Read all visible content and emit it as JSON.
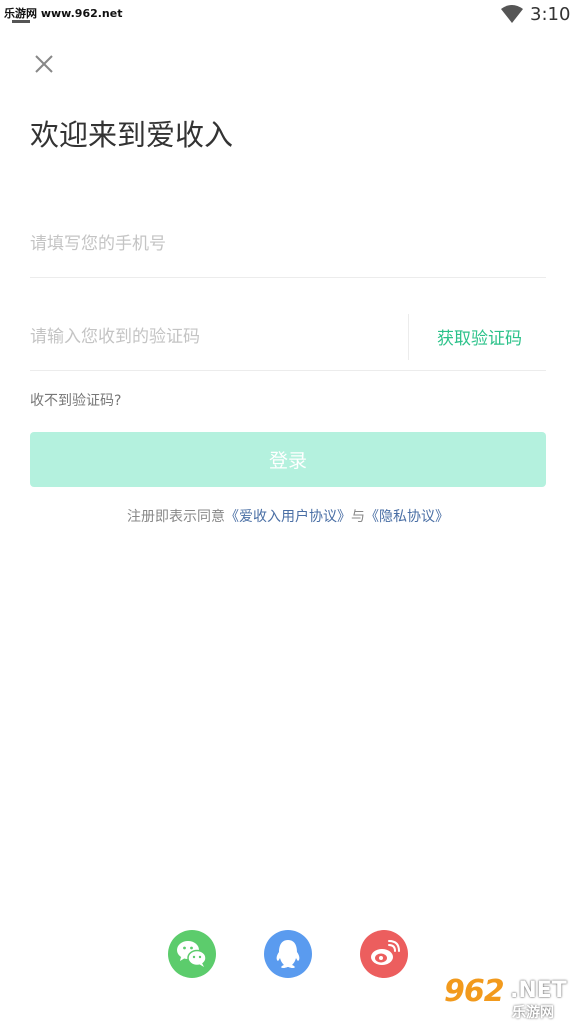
{
  "status_bar": {
    "watermark_text": "乐游网 www.962.net",
    "time": "3:10"
  },
  "page": {
    "welcome_title": "欢迎来到爱收入"
  },
  "form": {
    "phone_placeholder": "请填写您的手机号",
    "code_placeholder": "请输入您收到的验证码",
    "get_code_label": "获取验证码",
    "no_code_label": "收不到验证码?",
    "login_label": "登录"
  },
  "agreement": {
    "prefix": "注册即表示同意",
    "user_agreement": "《爱收入用户协议》",
    "joiner": "与",
    "privacy": "《隐私协议》"
  },
  "social": {
    "icons": [
      "wechat-icon",
      "qq-icon",
      "weibo-icon"
    ]
  },
  "watermark": {
    "number": "962",
    "suffix": ".NET",
    "cn": "乐游网"
  },
  "colors": {
    "accent": "#2cc28a",
    "login_button": "#b4f1de",
    "link": "#4a6fa5",
    "wechat": "#5ccc6c",
    "qq": "#5a9bef",
    "weibo": "#ec5e5e"
  }
}
